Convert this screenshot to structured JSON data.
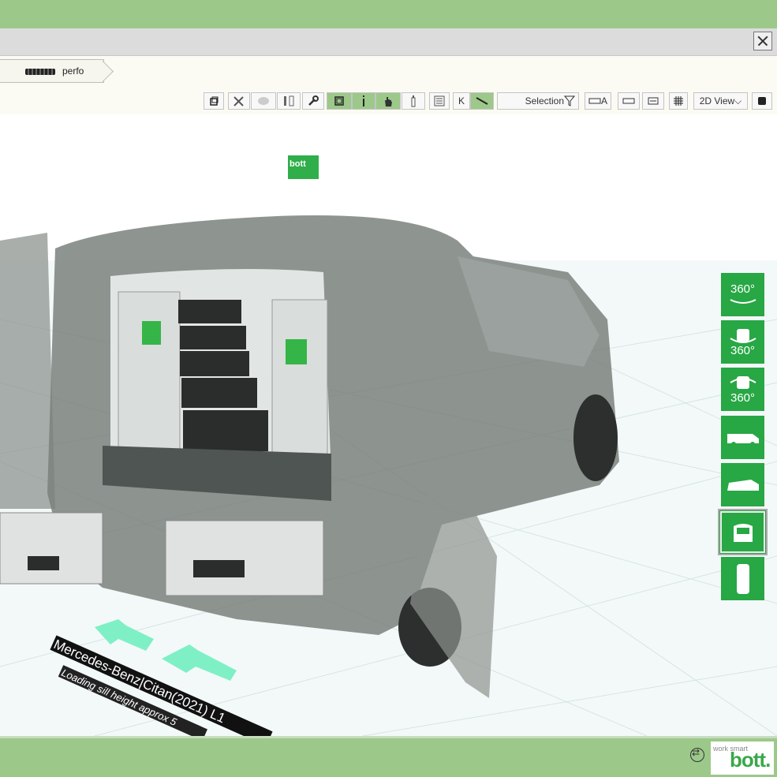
{
  "breadcrumb": {
    "item_label": "perfo"
  },
  "toolbar": {
    "k_label": "K",
    "selection_label": "Selection",
    "a_label": "A",
    "view_mode": "2D View"
  },
  "scene": {
    "logo_text": "bott",
    "vehicle_label": "Mercedes-Benz|Citan(2021) L1",
    "sill_label": "Loading sill height approx 5",
    "floor_color": "#f2f8f8",
    "van_color": "#6f7773"
  },
  "side_toolbar": {
    "rotate_360_label": "360°",
    "rotate_left_label": "360°",
    "rotate_right_label": "360°",
    "views": [
      "side view",
      "perspective",
      "front",
      "top"
    ]
  },
  "footer": {
    "brand_small": "work smart",
    "brand_main": "bott."
  },
  "colors": {
    "accent_green": "#9cc98a",
    "button_green": "#28a745"
  }
}
